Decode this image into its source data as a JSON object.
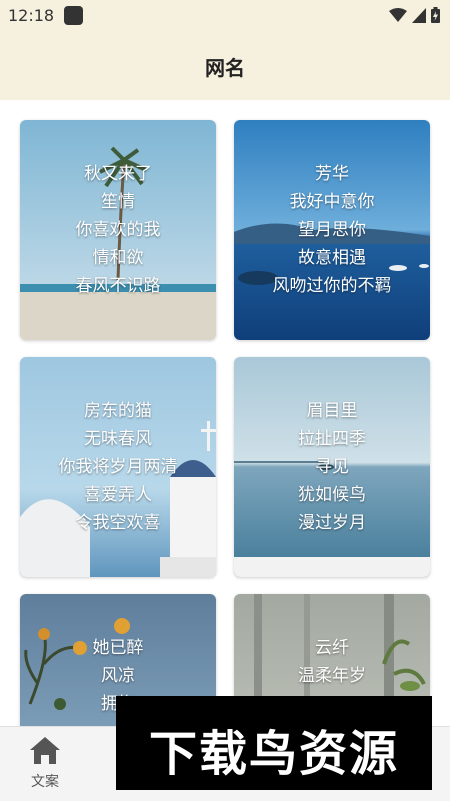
{
  "status_bar": {
    "time": "12:18",
    "icons": [
      "app-icon",
      "wifi-icon",
      "signal-icon",
      "battery-icon"
    ]
  },
  "header": {
    "title": "网名"
  },
  "cards": [
    {
      "lines": [
        "秋又来了",
        "笙情",
        "你喜欢的我",
        "情和欲",
        "春风不识路"
      ]
    },
    {
      "lines": [
        "芳华",
        "我好中意你",
        "望月思你",
        "故意相遇",
        "风吻过你的不羁"
      ]
    },
    {
      "lines": [
        "房东的猫",
        "无味春风",
        "你我将岁月两清",
        "喜爱弄人",
        "令我空欢喜"
      ]
    },
    {
      "lines": [
        "眉目里",
        "拉扯四季",
        "寻见",
        "犹如候鸟",
        "漫过岁月"
      ]
    },
    {
      "lines": [
        "她已醉",
        "风凉",
        "拥抱",
        "",
        ""
      ]
    },
    {
      "lines": [
        "云纤",
        "温柔年岁",
        "",
        "",
        ""
      ]
    }
  ],
  "tab_bar": {
    "items": [
      {
        "label": "文案",
        "icon": "home-icon"
      }
    ]
  },
  "watermark": {
    "text": "下载鸟资源"
  }
}
